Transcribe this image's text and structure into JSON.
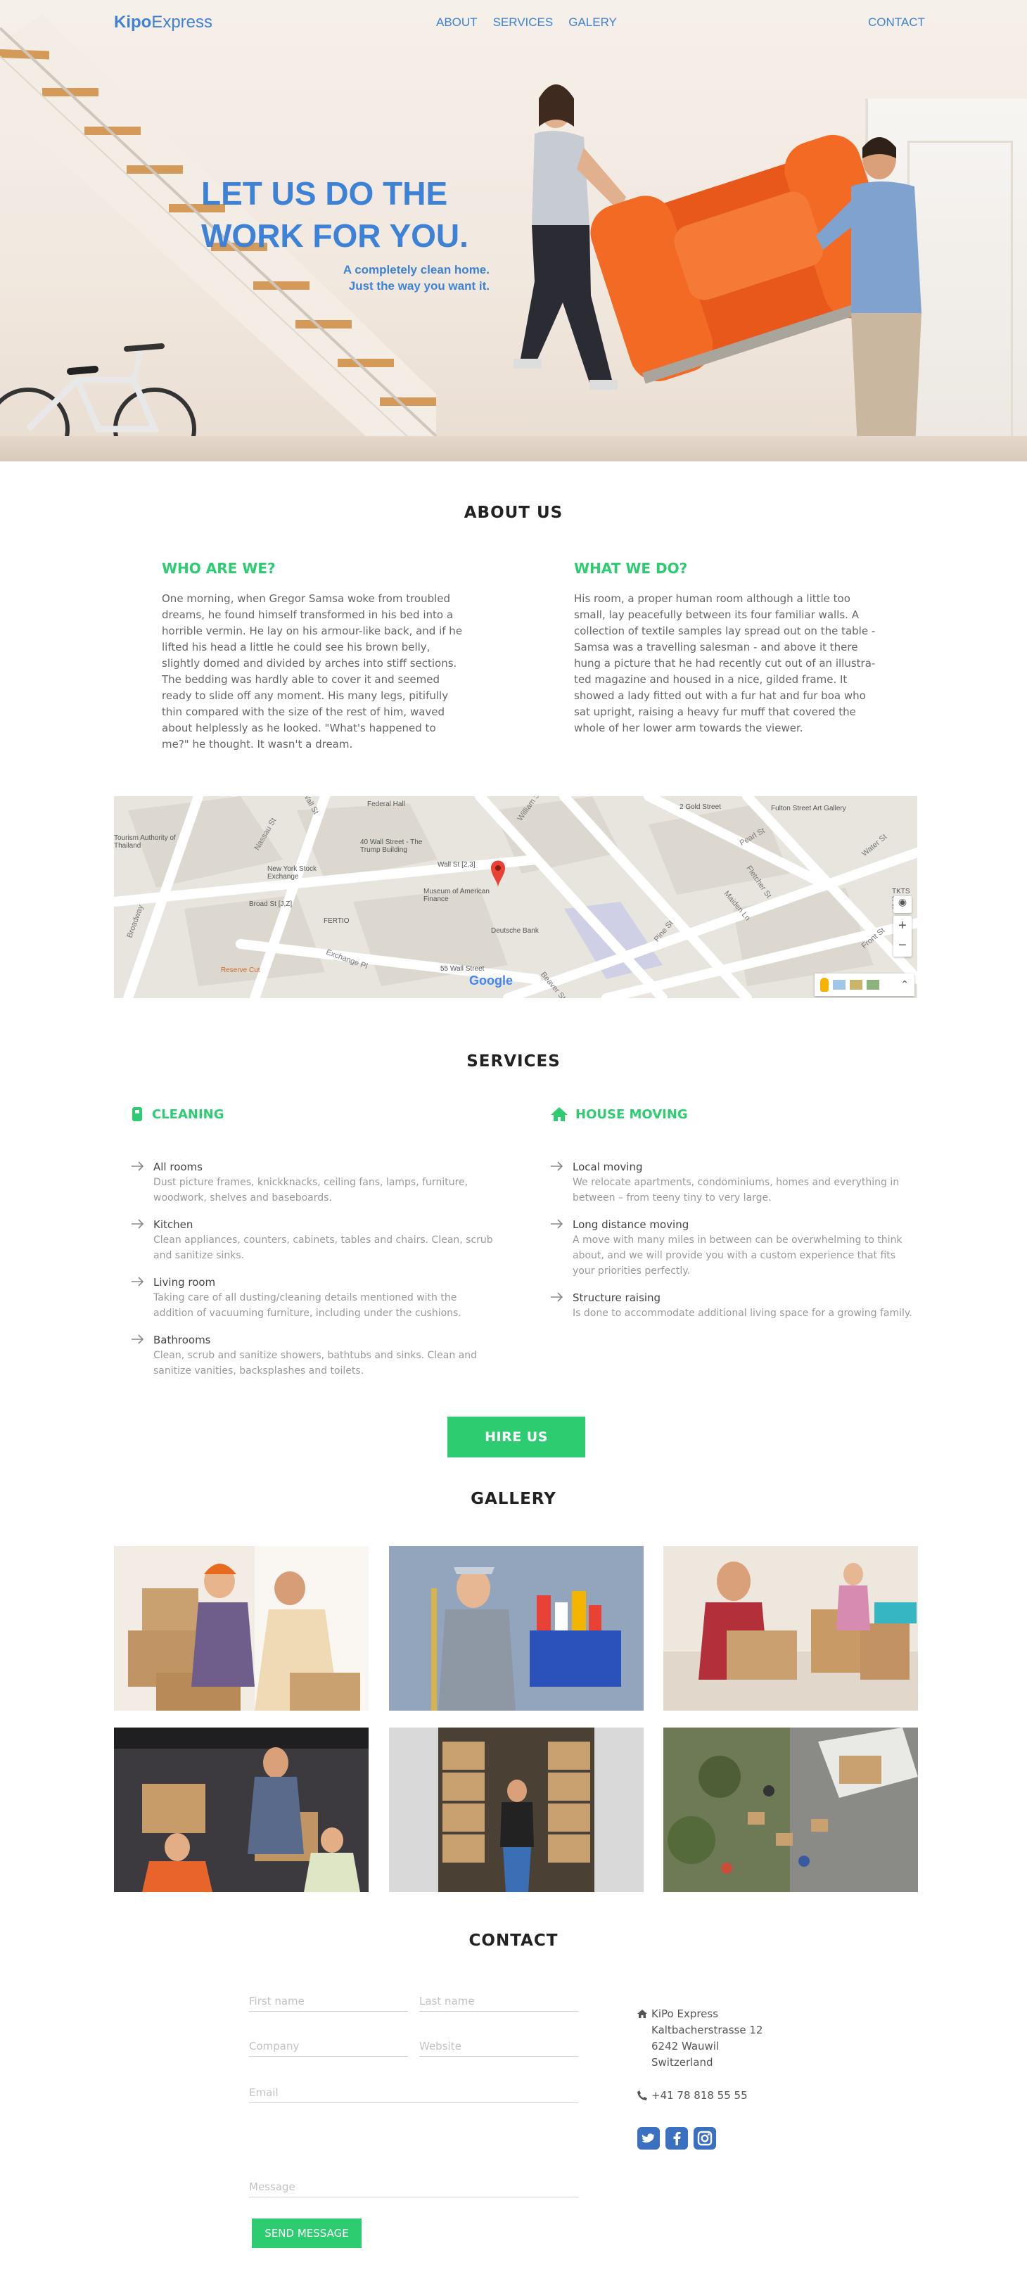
{
  "brand": {
    "bold": "Kipo",
    "rest": "Express"
  },
  "nav": {
    "links": [
      "ABOUT",
      "SERVICES",
      "GALERY"
    ],
    "contact": "CONTACT"
  },
  "hero": {
    "title_line1": "LET US DO THE",
    "title_line2": "WORK FOR YOU.",
    "sub_line1": "A completely clean home.",
    "sub_line2": "Just the way you want it."
  },
  "about": {
    "title": "ABOUT US",
    "left": {
      "heading": "WHO ARE WE?",
      "text": "One morning, when Gregor Samsa woke from troubled dreams, he found himself transformed in his bed into a horrible vermin. He lay on his armour-like back, and if he lifted his head a little he could see his brown belly, slightly domed and divided by arches into stiff sections. The bedding was hardly able to cover it and seemed ready to slide off any moment. His many legs, pitifully thin compared with the size of the rest of him, waved about helplessly as he looked. \"What's happened to me?\" he thought. It wasn't a dream."
    },
    "right": {
      "heading": "WHAT WE DO?",
      "text": "His room, a proper human room although a little too small, lay peacefully between its four familiar walls. A collection of textile samples lay spread out on the table - Samsa was a travelling salesman - and above it there hung a picture that he had recently cut out of an illustra-ted magazine and housed in a nice, gilded frame. It showed a lady fitted out with a fur hat and fur boa who sat upright, raising a heavy fur muff that covered the whole of her lower arm towards the viewer."
    }
  },
  "map": {
    "labels": [
      "Federal Hall",
      "2 Gold Street",
      "Fulton Street Art Gallery",
      "Tourism Authority of Thailand",
      "40 Wall Street - The Trump Building",
      "Wall St [2,3]",
      "New York Stock Exchange",
      "Museum of American Finance",
      "Broad St [J,Z]",
      "FERTIO",
      "Deutsche Bank",
      "55 Wall Street",
      "Reserve Cut",
      "TKTS South Street"
    ],
    "streets": [
      "Wall St",
      "William St",
      "Pearl St",
      "Water St",
      "Fletcher St",
      "Maiden Ln",
      "Pine St",
      "Front St",
      "Broadway",
      "Exchange Pl",
      "Beaver St",
      "Nassau St"
    ],
    "logo": "Google",
    "zoom_in": "+",
    "zoom_out": "−"
  },
  "services": {
    "title": "SERVICES",
    "cleaning": {
      "heading": "CLEANING",
      "items": [
        {
          "name": "All rooms",
          "desc": "Dust picture frames, knickknacks, ceiling fans, lamps, furniture, woodwork, shelves and baseboards."
        },
        {
          "name": "Kitchen",
          "desc": "Clean appliances, counters, cabinets, tables and chairs. Clean, scrub and sanitize sinks."
        },
        {
          "name": "Living room",
          "desc": "Taking  care of all dusting/cleaning details mentioned with the addition of vacuuming furniture, including under the cushions."
        },
        {
          "name": "Bathrooms",
          "desc": "Clean, scrub and sanitize showers, bathtubs and sinks. Clean and sanitize vanities, backsplashes and toilets."
        }
      ]
    },
    "moving": {
      "heading": "HOUSE MOVING",
      "items": [
        {
          "name": "Local moving",
          "desc": "We relocate apartments, condominiums, homes and everything in between – from teeny tiny to very large."
        },
        {
          "name": "Long distance moving",
          "desc": "A move with many miles in between can be overwhelming to think about, and we will provide you with a custom experience that fits your priorities perfectly."
        },
        {
          "name": "Structure raising",
          "desc": "Is done to accommodate additional living space for a growing family."
        }
      ]
    },
    "cta": "HIRE US"
  },
  "gallery": {
    "title": "GALLERY"
  },
  "contact": {
    "title": "CONTACT",
    "form": {
      "first_name": "First name",
      "last_name": "Last name",
      "company": "Company",
      "website": "Website",
      "email": "Email",
      "message": "Message",
      "submit": "SEND MESSAGE"
    },
    "address": {
      "name": "KiPo Express",
      "street": "Kaltbacherstrasse 12",
      "city": "6242 Wauwil",
      "country": "Switzerland",
      "phone": "+41 78 818 55 55"
    }
  },
  "colors": {
    "accent_blue": "#3d82d6",
    "accent_green": "#2ecc71",
    "social_blue": "#3b6fc0"
  }
}
